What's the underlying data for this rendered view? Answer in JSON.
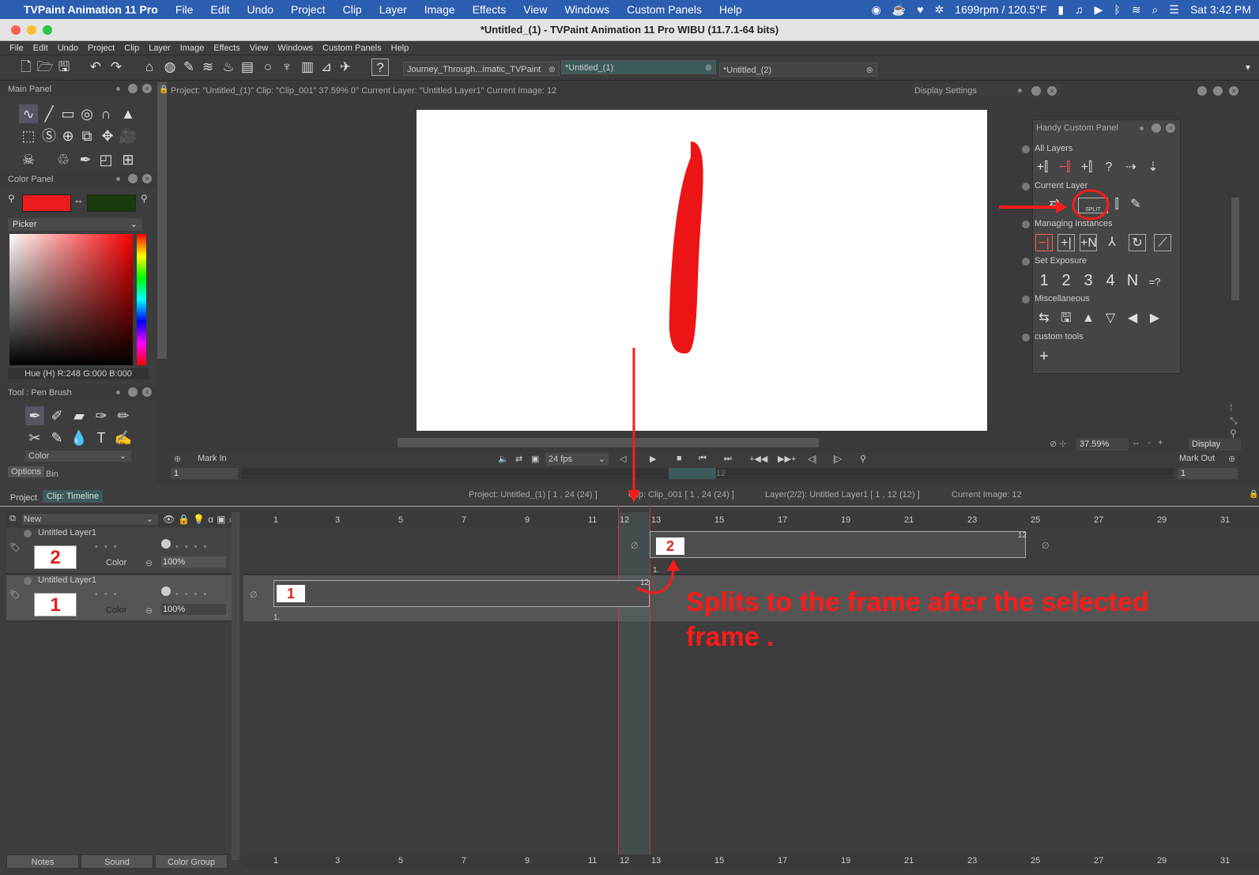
{
  "macbar": {
    "app_name": "TVPaint Animation 11 Pro",
    "menus": [
      "File",
      "Edit",
      "Undo",
      "Project",
      "Clip",
      "Layer",
      "Image",
      "Effects",
      "View",
      "Windows",
      "Custom Panels",
      "Help"
    ],
    "status_temp": "1699rpm / 120.5°F",
    "clock": "Sat  3:42 PM"
  },
  "window_title": "*Untitled_(1) - TVPaint Animation 11 Pro WIBU (11.7.1-64 bits)",
  "app_menu": [
    "File",
    "Edit",
    "Undo",
    "Project",
    "Clip",
    "Layer",
    "Image",
    "Effects",
    "View",
    "Windows",
    "Custom Panels",
    "Help"
  ],
  "tabs": [
    {
      "label": "Journey_Through...imatic_TVPaint"
    },
    {
      "label": "*Untitled_(1)"
    },
    {
      "label": "*Untitled_(2)"
    }
  ],
  "main_panel": {
    "title": "Main Panel"
  },
  "color_panel": {
    "title": "Color Panel",
    "picker_label": "Picker",
    "readout": "Hue (H) R:248 G:000 B:000",
    "primary_color": "#ec1c1c",
    "secondary_color": "#173b0c"
  },
  "tool_panel": {
    "title": "Tool : Pen Brush",
    "mode": "Color",
    "options_tab": "Options",
    "bin_tab": "Bin"
  },
  "project_info": "Project: \"Untitled_(1)\" Clip: \"Clip_001\"  37.59%  0°  Current Layer: \"Untitled Layer1\"  Current Image: 12",
  "display_settings": {
    "title": "Display Settings"
  },
  "handy_panel": {
    "title": "Handy Custom Panel",
    "sections": [
      "All Layers",
      "Current Layer",
      "Managing Instances",
      "Set Exposure",
      "Miscellaneous",
      "custom tools"
    ],
    "exposure_buttons": [
      "1",
      "2",
      "3",
      "4",
      "N",
      "=?"
    ],
    "split_label": "SPLIT"
  },
  "view_controls": {
    "zoom": "37.59%",
    "display_label": "Display"
  },
  "transport": {
    "mark_in": "Mark In",
    "mark_out": "Mark Out",
    "fps": "24 fps",
    "mark_in_value": "1",
    "mark_out_value": "1",
    "current_frame_ghost": "12"
  },
  "timeline_tabs": {
    "project": "Project",
    "clip": "Clip: Timeline"
  },
  "timeline_info": {
    "project": "Project: Untitled_(1) [ 1 , 24  (24) ]",
    "clip": "Clip: Clip_001 [ 1 , 24  (24) ]",
    "layer": "Layer(2/2): Untitled Layer1 [ 1 , 12  (12) ]",
    "current": "Current Image: 12"
  },
  "layer_header": {
    "new_label": "New"
  },
  "layers": [
    {
      "name": "Untitled Layer1",
      "mode": "Color",
      "opacity": "100%",
      "thumb": "2",
      "instance_label": "2",
      "frame_count": "12",
      "instance_no": "1."
    },
    {
      "name": "Untitled Layer1",
      "mode": "Color",
      "opacity": "100%",
      "thumb": "1",
      "instance_label": "1",
      "frame_count": "12",
      "instance_no": "1."
    }
  ],
  "ruler_numbers": [
    "1",
    "3",
    "5",
    "7",
    "9",
    "11",
    "12",
    "13",
    "15",
    "17",
    "19",
    "21",
    "23",
    "25",
    "27",
    "29",
    "31"
  ],
  "annotation": {
    "text_line1": "Splits to the frame after the selected",
    "text_line2": "frame .",
    "color": "#ff1a1a"
  },
  "bottom_tabs": [
    "Notes",
    "Sound",
    "Color Group"
  ]
}
